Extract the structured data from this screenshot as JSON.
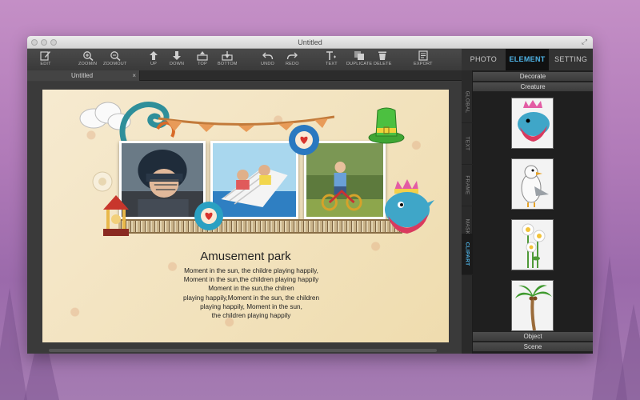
{
  "window": {
    "title": "Untitled"
  },
  "toolbar": {
    "items": [
      {
        "label": "EDIT",
        "icon": "edit-icon"
      },
      {
        "label": "ZOOMIN",
        "icon": "zoom-in-icon"
      },
      {
        "label": "ZOOMOUT",
        "icon": "zoom-out-icon"
      },
      {
        "label": "UP",
        "icon": "arrow-up-icon"
      },
      {
        "label": "DOWN",
        "icon": "arrow-down-icon"
      },
      {
        "label": "TOP",
        "icon": "bring-to-top-icon"
      },
      {
        "label": "BOTTOM",
        "icon": "send-to-bottom-icon"
      },
      {
        "label": "UNDO",
        "icon": "undo-icon"
      },
      {
        "label": "REDO",
        "icon": "redo-icon"
      },
      {
        "label": "TEXT",
        "icon": "text-icon"
      },
      {
        "label": "DUPLICATE",
        "icon": "duplicate-icon"
      },
      {
        "label": "DELETE",
        "icon": "trash-icon"
      },
      {
        "label": "EXPORT",
        "icon": "export-icon"
      }
    ]
  },
  "right_tabs": {
    "photo": "PHOTO",
    "element": "ELEMENT",
    "setting": "SETTING",
    "active": "ELEMENT"
  },
  "doc_tab": {
    "label": "Untitled",
    "close": "×"
  },
  "side_tabs": {
    "global": "GLOBAL",
    "text": "TEXT",
    "frame": "FRAME",
    "mask": "MASK",
    "clipart": "CLIPART",
    "active": "CLIPART"
  },
  "panel": {
    "categories_top": {
      "decorate": "Decorate",
      "creature": "Creature"
    },
    "categories_bottom": {
      "object": "Object",
      "scene": "Scene"
    },
    "thumbnails": [
      "bird-clipart",
      "seagull-clipart",
      "daisy-clipart",
      "palm-tree-clipart"
    ]
  },
  "canvas": {
    "title": "Amusement park",
    "body": [
      "Moment in the sun, the childre playing happily,",
      "Moment in the sun,the children playing happily",
      "Moment in the sun,the chilren",
      "playing happily,Moment in the sun, the children",
      "playing happily, Moment in the sun,",
      "the children playing happily"
    ],
    "background_color": "#f2e4bd"
  },
  "colors": {
    "accent": "#4fb5e8",
    "panel": "#1f1f1f",
    "toolbar": "#3a3a3a"
  }
}
